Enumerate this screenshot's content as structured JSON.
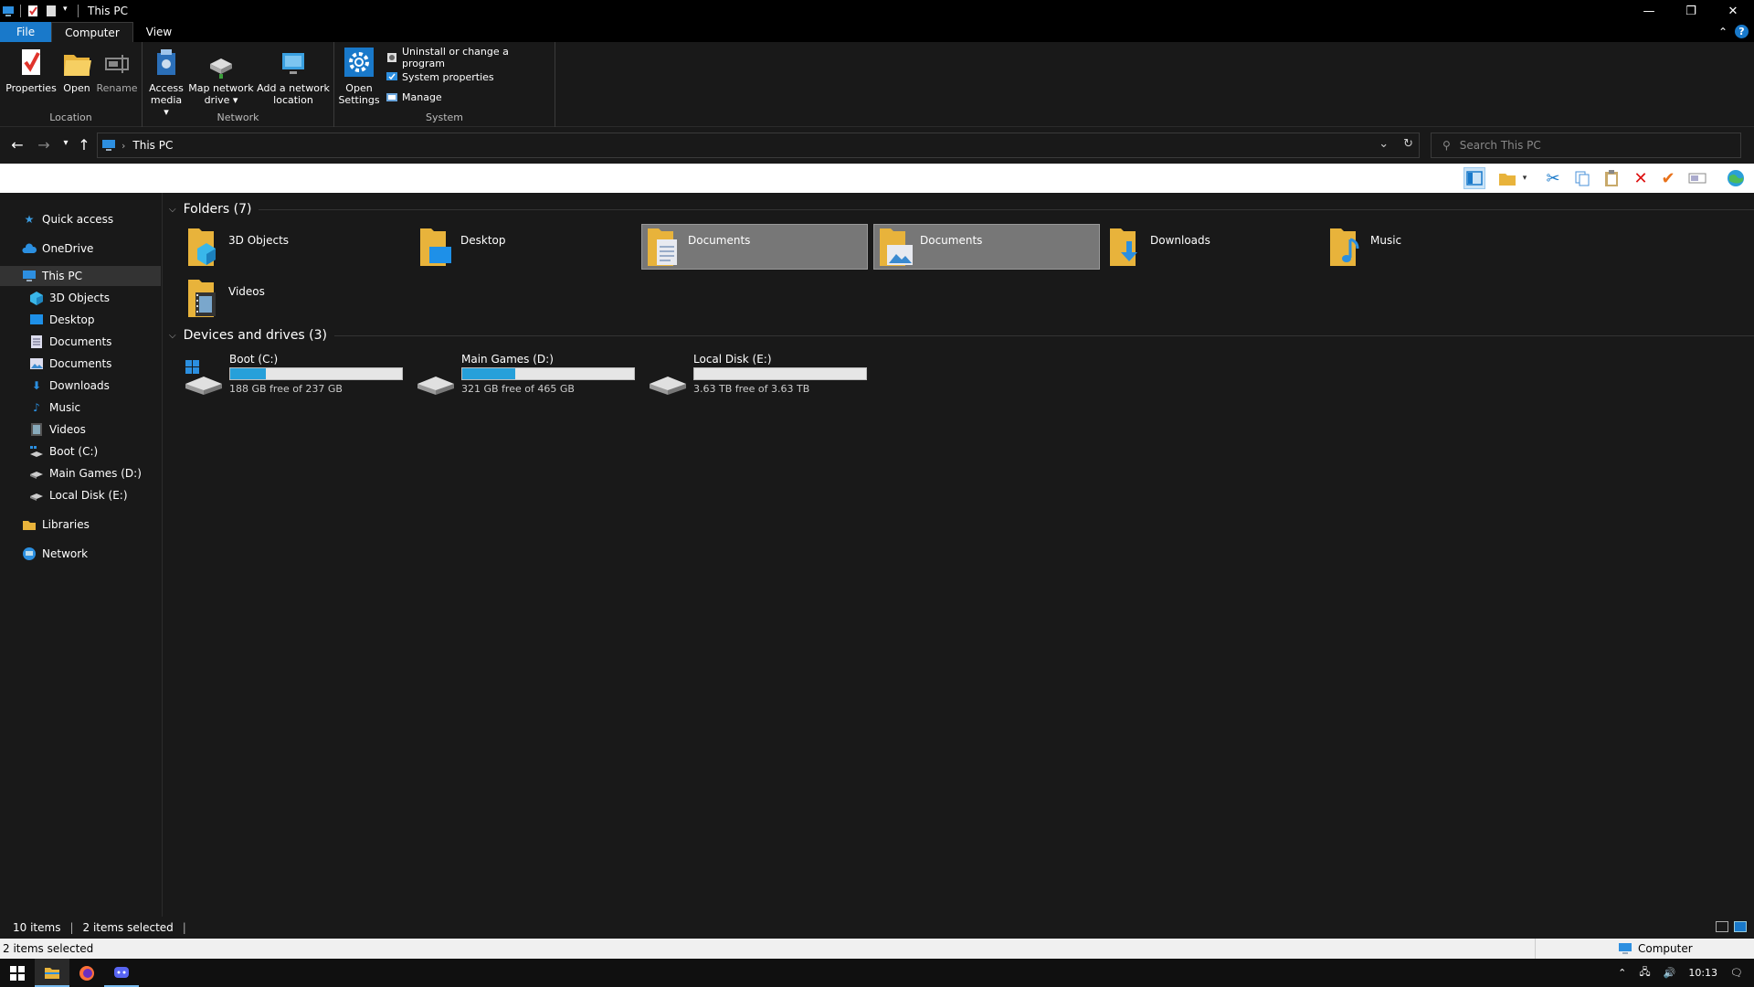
{
  "window": {
    "title": "This PC",
    "controls": {
      "minimize": "—",
      "restore": "❐",
      "close": "✕"
    }
  },
  "ribbon_tabs": [
    "File",
    "Computer",
    "View"
  ],
  "ribbon": {
    "location": {
      "label": "Location",
      "properties": "Properties",
      "open": "Open",
      "rename": "Rename"
    },
    "network": {
      "label": "Network",
      "access_media_1": "Access",
      "access_media_2": "media ▾",
      "map_drive_1": "Map network",
      "map_drive_2": "drive ▾",
      "add_location_1": "Add a network",
      "add_location_2": "location"
    },
    "system": {
      "label": "System",
      "open_settings_1": "Open",
      "open_settings_2": "Settings",
      "uninstall": "Uninstall or change a program",
      "system_properties": "System properties",
      "manage": "Manage"
    }
  },
  "address": {
    "path": "This PC",
    "search_placeholder": "Search This PC"
  },
  "nav_pane": [
    {
      "label": "Quick access",
      "icon": "star-icon"
    },
    {
      "label": "OneDrive",
      "icon": "cloud-icon"
    },
    {
      "label": "This PC",
      "icon": "computer-icon",
      "selected": true
    },
    {
      "label": "3D Objects",
      "icon": "3d-objects-icon",
      "child": true
    },
    {
      "label": "Desktop",
      "icon": "desktop-icon",
      "child": true
    },
    {
      "label": "Documents",
      "icon": "documents-icon",
      "child": true
    },
    {
      "label": "Documents",
      "icon": "pictures-icon",
      "child": true
    },
    {
      "label": "Downloads",
      "icon": "download-icon",
      "child": true
    },
    {
      "label": "Music",
      "icon": "music-icon",
      "child": true
    },
    {
      "label": "Videos",
      "icon": "video-icon",
      "child": true
    },
    {
      "label": "Boot (C:)",
      "icon": "system-drive-icon",
      "child": true
    },
    {
      "label": "Main Games (D:)",
      "icon": "drive-icon",
      "child": true
    },
    {
      "label": "Local Disk (E:)",
      "icon": "drive-icon",
      "child": true
    },
    {
      "label": "Libraries",
      "icon": "library-icon"
    },
    {
      "label": "Network",
      "icon": "network-icon"
    }
  ],
  "sections": {
    "folders": "Folders (7)",
    "drives": "Devices and drives (3)"
  },
  "folders": [
    {
      "label": "3D Objects",
      "icon": "3d-objects-folder-icon",
      "selected": false
    },
    {
      "label": "Desktop",
      "icon": "desktop-folder-icon",
      "selected": false
    },
    {
      "label": "Documents",
      "icon": "documents-folder-icon",
      "selected": true
    },
    {
      "label": "Documents",
      "icon": "pictures-folder-icon",
      "selected": true
    },
    {
      "label": "Downloads",
      "icon": "downloads-folder-icon",
      "selected": false
    },
    {
      "label": "Music",
      "icon": "music-folder-icon",
      "selected": false
    },
    {
      "label": "Videos",
      "icon": "videos-folder-icon",
      "selected": false
    }
  ],
  "drives": [
    {
      "label": "Boot (C:)",
      "free": "188 GB free of 237 GB",
      "used_fraction": 0.21,
      "icon": "windows-drive-icon"
    },
    {
      "label": "Main Games (D:)",
      "free": "321 GB free of 465 GB",
      "used_fraction": 0.31,
      "icon": "hdd-icon"
    },
    {
      "label": "Local Disk (E:)",
      "free": "3.63 TB free of 3.63 TB",
      "used_fraction": 0.0,
      "icon": "hdd-icon"
    }
  ],
  "status": {
    "items": "10 items",
    "selected": "2 items selected",
    "bottom_selected": "2 items selected",
    "zone": "Computer"
  },
  "tray": {
    "time": "10:13"
  },
  "colors": {
    "accent": "#1979ca",
    "drive_bar": "#26a0da",
    "selection": "#777777"
  }
}
